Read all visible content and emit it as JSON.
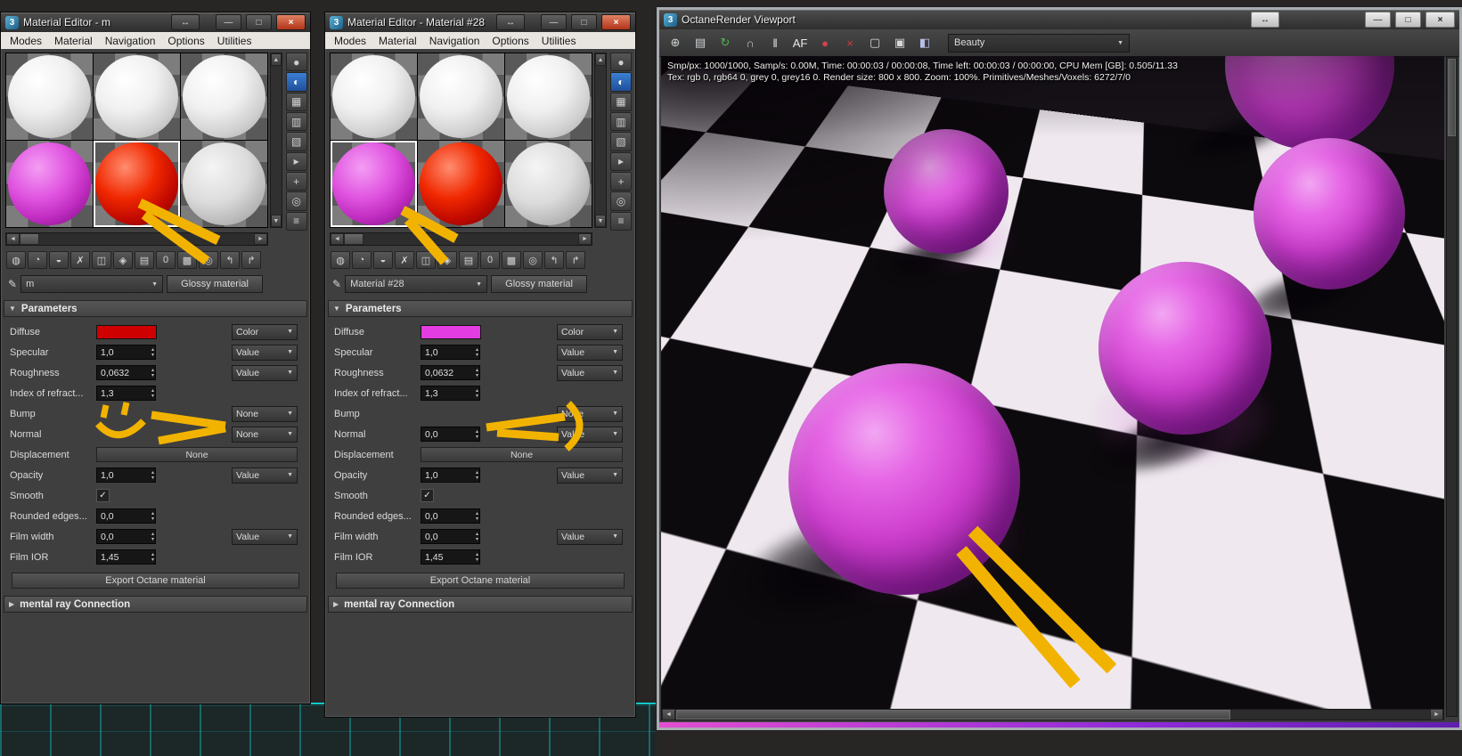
{
  "annotation_color": "#f2b300",
  "app_icon_text": "3",
  "window_controls": {
    "expand": "↔",
    "minimize": "—",
    "maximize": "□",
    "close": "×"
  },
  "editor_chrome": {
    "pencil_icon": "✎",
    "dropdown_arrow": "▼",
    "rollout_open_icon": "▼",
    "rollout_closed_icon": "▶",
    "check_icon": "✓",
    "spinner_up_icon": "▴",
    "spinner_down_icon": "▾",
    "scroll_left_icon": "◄",
    "scroll_right_icon": "►",
    "scroll_up_icon": "▲",
    "scroll_down_icon": "▼",
    "toolbar_icons": [
      {
        "name": "get-material-icon",
        "glyph": "◍"
      },
      {
        "name": "put-material-to-scene-icon",
        "glyph": "◔"
      },
      {
        "name": "assign-material-to-selection-icon",
        "glyph": "◒"
      },
      {
        "name": "reset-map-icon",
        "glyph": "✗"
      },
      {
        "name": "make-material-copy-icon",
        "glyph": "◫"
      },
      {
        "name": "make-unique-icon",
        "glyph": "◈"
      },
      {
        "name": "put-to-library-icon",
        "glyph": "▤"
      },
      {
        "name": "material-id-channel-icon",
        "glyph": "0"
      },
      {
        "name": "show-shaded-material-in-viewport-icon",
        "glyph": "▩"
      },
      {
        "name": "show-end-result-icon",
        "glyph": "◎"
      },
      {
        "name": "go-to-parent-icon",
        "glyph": "↰"
      },
      {
        "name": "go-forward-to-sibling-icon",
        "glyph": "↱"
      }
    ],
    "side_icons": [
      {
        "name": "sample-type-icon",
        "glyph": "●"
      },
      {
        "name": "backlight-icon",
        "glyph": "◐",
        "active": true
      },
      {
        "name": "background-icon",
        "glyph": "▦"
      },
      {
        "name": "sample-uv-tiling-icon",
        "glyph": "▥"
      },
      {
        "name": "video-color-check-icon",
        "glyph": "▧"
      },
      {
        "name": "make-preview-icon",
        "glyph": "▸"
      },
      {
        "name": "options-icon",
        "glyph": "+"
      },
      {
        "name": "select-by-material-icon",
        "glyph": "◎"
      },
      {
        "name": "material-map-navigator-icon",
        "glyph": "≡"
      }
    ]
  },
  "left_editor": {
    "title": "Material Editor - m",
    "menus": [
      "Modes",
      "Material",
      "Navigation",
      "Options",
      "Utilities"
    ],
    "samples": [
      {
        "color": "white"
      },
      {
        "color": "white"
      },
      {
        "color": "white"
      },
      {
        "color": "magenta"
      },
      {
        "color": "red",
        "selected": true
      },
      {
        "color": "gray"
      }
    ],
    "material_name": "m",
    "type_button": "Glossy material",
    "parameters_title": "Parameters",
    "rows": [
      {
        "label": "Diffuse",
        "type": "swatch",
        "swatch": "#cf0000",
        "dropdown": "Color"
      },
      {
        "label": "Specular",
        "type": "spinner",
        "value": "1,0",
        "dropdown": "Value"
      },
      {
        "label": "Roughness",
        "type": "spinner",
        "value": "0,0632",
        "dropdown": "Value"
      },
      {
        "label": "Index of refract...",
        "type": "spinner",
        "value": "1,3"
      },
      {
        "label": "Bump",
        "type": "none",
        "dropdown": "None"
      },
      {
        "label": "Normal",
        "type": "none",
        "dropdown": "None"
      },
      {
        "label": "Displacement",
        "type": "button",
        "value": "None"
      },
      {
        "label": "Opacity",
        "type": "spinner",
        "value": "1,0",
        "dropdown": "Value"
      },
      {
        "label": "Smooth",
        "type": "check",
        "checked": true
      },
      {
        "label": "Rounded edges...",
        "type": "spinner",
        "value": "0,0"
      },
      {
        "label": "Film width",
        "type": "spinner",
        "value": "0,0",
        "dropdown": "Value"
      },
      {
        "label": "Film IOR",
        "type": "spinner",
        "value": "1,45"
      }
    ],
    "export_button": "Export Octane material",
    "mental_ray_rollout": "mental ray Connection"
  },
  "right_editor": {
    "title": "Material Editor - Material #28",
    "menus": [
      "Modes",
      "Material",
      "Navigation",
      "Options",
      "Utilities"
    ],
    "samples": [
      {
        "color": "white"
      },
      {
        "color": "white"
      },
      {
        "color": "white"
      },
      {
        "color": "magenta",
        "selected": true
      },
      {
        "color": "red"
      },
      {
        "color": "gray"
      }
    ],
    "material_name": "Material #28",
    "type_button": "Glossy material",
    "parameters_title": "Parameters",
    "rows": [
      {
        "label": "Diffuse",
        "type": "swatch",
        "swatch": "#e23ce2",
        "dropdown": "Color"
      },
      {
        "label": "Specular",
        "type": "spinner",
        "value": "1,0",
        "dropdown": "Value"
      },
      {
        "label": "Roughness",
        "type": "spinner",
        "value": "0,0632",
        "dropdown": "Value"
      },
      {
        "label": "Index of refract...",
        "type": "spinner",
        "value": "1,3"
      },
      {
        "label": "Bump",
        "type": "none",
        "dropdown": "None"
      },
      {
        "label": "Normal",
        "type": "spinner",
        "value": "0,0",
        "dropdown": "Value"
      },
      {
        "label": "Displacement",
        "type": "button",
        "value": "None"
      },
      {
        "label": "Opacity",
        "type": "spinner",
        "value": "1,0",
        "dropdown": "Value"
      },
      {
        "label": "Smooth",
        "type": "check",
        "checked": true
      },
      {
        "label": "Rounded edges...",
        "type": "spinner",
        "value": "0,0"
      },
      {
        "label": "Film width",
        "type": "spinner",
        "value": "0,0",
        "dropdown": "Value"
      },
      {
        "label": "Film IOR",
        "type": "spinner",
        "value": "1,45"
      }
    ],
    "export_button": "Export Octane material",
    "mental_ray_rollout": "mental ray Connection"
  },
  "octane": {
    "title": "OctaneRender Viewport",
    "render_mode": "Beauty",
    "status_line1": "Smp/px: 1000/1000,  Samp/s: 0.00M,  Time: 00:00:03 / 00:00:08,  Time left: 00:00:03 / 00:00:00,  CPU Mem [GB]: 0.505/11.33",
    "status_line2": "Tex: rgb 0, rgb64 0, grey 0, grey16 0.  Render size: 800 x 800.  Zoom: 100%.  Primitives/Meshes/Voxels: 6272/7/0",
    "toolbar_icons": [
      {
        "name": "pick-material-icon",
        "glyph": "⊕",
        "color": "#cfd3d6"
      },
      {
        "name": "save-render-icon",
        "glyph": "▤",
        "color": "#cfd3d6"
      },
      {
        "name": "restart-render-icon",
        "glyph": "↻",
        "color": "#54b14f"
      },
      {
        "name": "lock-icon",
        "glyph": "∩",
        "color": "#c0c6cc"
      },
      {
        "name": "pause-icon",
        "glyph": "‖",
        "color": "#e8e8e8"
      },
      {
        "name": "text-overlay-icon",
        "glyph": "AF",
        "color": "#e8e8e8"
      },
      {
        "name": "material-ball-icon",
        "glyph": "●",
        "color": "#d6404f"
      },
      {
        "name": "stop-render-icon",
        "glyph": "×",
        "color": "#d63a3a"
      },
      {
        "name": "monitor-icon",
        "glyph": "▢",
        "color": "#d8d8d8"
      },
      {
        "name": "camera-export-icon",
        "glyph": "▣",
        "color": "#d8d8d8"
      },
      {
        "name": "spectrum-icon",
        "glyph": "◧",
        "color": "#b9c0e8"
      }
    ]
  }
}
